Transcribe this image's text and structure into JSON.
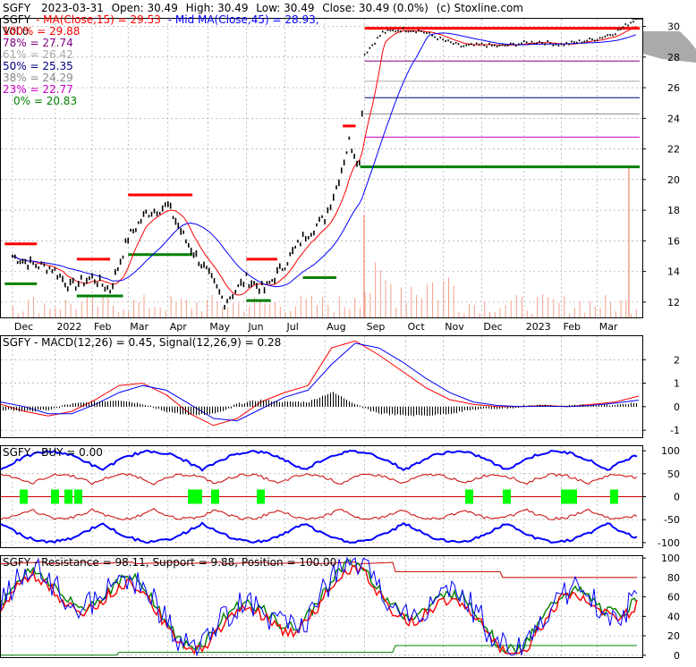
{
  "header": {
    "symbol": "SGFY",
    "date": "2023-03-31",
    "open": "Open: 30.49",
    "high": "High: 30.49",
    "low": "Low: 30.49",
    "close": "Close: 30.49 (0.0%)",
    "credit": "(c) Stoxline.com",
    "ma_fast": "MA(Close,15) = 29.53",
    "ma_slow": "Mid MA(Close,45) = 28.93,",
    "volume": "Vol 0"
  },
  "fib_levels": [
    {
      "label": "100% = 29.88",
      "value": 29.88,
      "color": "#ff0000"
    },
    {
      "label": "78% = 27.74",
      "value": 27.74,
      "color": "#800080"
    },
    {
      "label": "61% = 26.42",
      "value": 26.42,
      "color": "#aaaaaa"
    },
    {
      "label": "50% = 25.35",
      "value": 25.35,
      "color": "#000080"
    },
    {
      "label": "38% = 24.29",
      "value": 24.29,
      "color": "#888888"
    },
    {
      "label": "23% = 22.77",
      "value": 22.77,
      "color": "#cc00cc"
    },
    {
      "label": "0% = 20.83",
      "value": 20.83,
      "color": "#008000"
    }
  ],
  "panels": {
    "macd_title": "SGFY - MACD(12,26) = 0.45, Signal(12,26,9) = 0.28",
    "buy_title": "SGFY - BUY = 0.00",
    "resistance_title": "SGFY - Resistance = 98.11, Support = 9.88, Position = 100.00"
  },
  "chart_data": [
    {
      "type": "candlestick",
      "x_ticks": [
        "Dec",
        "2022",
        "Feb",
        "Mar",
        "Apr",
        "May",
        "Jun",
        "Jul",
        "Aug",
        "Sep",
        "Oct",
        "Nov",
        "Dec",
        "2023",
        "Feb",
        "Mar"
      ],
      "y_ticks": [
        12,
        14,
        16,
        18,
        20,
        22,
        24,
        26,
        28,
        30
      ],
      "ylim": [
        11,
        30.5
      ],
      "close_series": [
        {
          "date": "2021-12-01",
          "value": 15.0
        },
        {
          "date": "2021-12-15",
          "value": 14.5
        },
        {
          "date": "2022-01-01",
          "value": 14.2
        },
        {
          "date": "2022-01-15",
          "value": 13.0
        },
        {
          "date": "2022-02-01",
          "value": 13.6
        },
        {
          "date": "2022-02-15",
          "value": 12.8
        },
        {
          "date": "2022-03-01",
          "value": 16.2
        },
        {
          "date": "2022-03-15",
          "value": 17.8
        },
        {
          "date": "2022-04-01",
          "value": 18.3
        },
        {
          "date": "2022-04-15",
          "value": 16.0
        },
        {
          "date": "2022-05-01",
          "value": 14.0
        },
        {
          "date": "2022-05-15",
          "value": 12.0
        },
        {
          "date": "2022-06-01",
          "value": 13.5
        },
        {
          "date": "2022-06-15",
          "value": 12.8
        },
        {
          "date": "2022-07-01",
          "value": 14.5
        },
        {
          "date": "2022-07-15",
          "value": 16.2
        },
        {
          "date": "2022-08-01",
          "value": 17.5
        },
        {
          "date": "2022-08-10",
          "value": 19.5
        },
        {
          "date": "2022-08-20",
          "value": 22.5
        },
        {
          "date": "2022-08-28",
          "value": 21.0
        },
        {
          "date": "2022-09-01",
          "value": 28.2
        },
        {
          "date": "2022-09-15",
          "value": 29.6
        },
        {
          "date": "2022-10-01",
          "value": 29.8
        },
        {
          "date": "2022-10-15",
          "value": 29.7
        },
        {
          "date": "2022-11-01",
          "value": 29.1
        },
        {
          "date": "2022-11-15",
          "value": 28.7
        },
        {
          "date": "2022-12-01",
          "value": 28.8
        },
        {
          "date": "2022-12-15",
          "value": 28.7
        },
        {
          "date": "2023-01-01",
          "value": 28.9
        },
        {
          "date": "2023-01-15",
          "value": 29.0
        },
        {
          "date": "2023-02-01",
          "value": 28.8
        },
        {
          "date": "2023-02-15",
          "value": 29.0
        },
        {
          "date": "2023-03-01",
          "value": 29.2
        },
        {
          "date": "2023-03-15",
          "value": 29.6
        },
        {
          "date": "2023-03-31",
          "value": 30.49
        }
      ]
    },
    {
      "type": "line",
      "y_ticks": [
        -1,
        0,
        1,
        2
      ],
      "ylim": [
        -1.3,
        3.0
      ],
      "series": [
        {
          "name": "MACD(12,26)",
          "color": "#ff0000",
          "values": [
            0.1,
            -0.2,
            -0.4,
            -0.2,
            0.3,
            0.9,
            1.0,
            0.5,
            -0.3,
            -0.8,
            -0.5,
            0.2,
            0.6,
            0.9,
            2.5,
            2.8,
            2.2,
            1.5,
            0.8,
            0.3,
            0.1,
            0.0,
            0.0,
            0.05,
            0.0,
            0.1,
            0.2,
            0.45
          ]
        },
        {
          "name": "Signal(12,26,9)",
          "color": "#0000ff",
          "values": [
            0.2,
            0.0,
            -0.3,
            -0.3,
            0.1,
            0.6,
            0.9,
            0.7,
            0.1,
            -0.5,
            -0.6,
            -0.1,
            0.4,
            0.7,
            1.8,
            2.7,
            2.5,
            1.9,
            1.2,
            0.6,
            0.2,
            0.05,
            0.0,
            0.02,
            0.0,
            0.05,
            0.15,
            0.28
          ]
        }
      ]
    },
    {
      "type": "line",
      "y_ticks": [
        -100,
        -50,
        0,
        50,
        100
      ],
      "ylim": [
        -110,
        110
      ],
      "series": [
        {
          "name": "BUY",
          "color": "#00ff00",
          "values": []
        }
      ]
    },
    {
      "type": "line",
      "y_ticks": [
        0,
        20,
        40,
        60,
        80,
        100
      ],
      "ylim": [
        -2,
        102
      ],
      "series": [
        {
          "name": "Resistance",
          "color": "#ff0000",
          "values": [
            98.11
          ]
        },
        {
          "name": "Support",
          "color": "#008000",
          "values": [
            9.88
          ]
        },
        {
          "name": "Position",
          "color": "#0000ff",
          "values": [
            100.0
          ]
        }
      ]
    }
  ]
}
